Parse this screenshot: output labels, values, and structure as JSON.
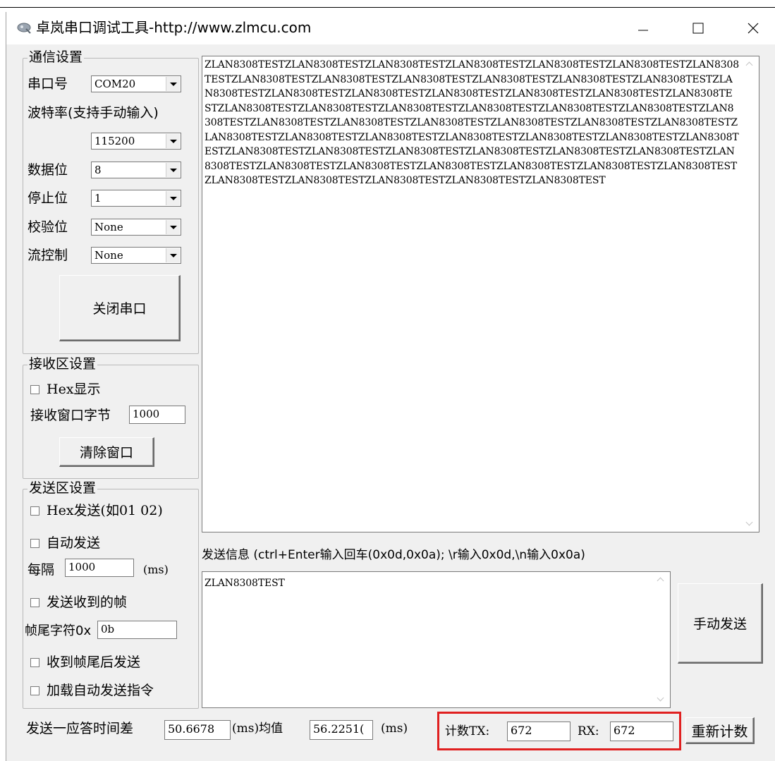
{
  "window": {
    "title": "卓岚串口调试工具-http://www.zlmcu.com"
  },
  "comm": {
    "legend": "通信设置",
    "port_label": "串口号",
    "port_value": "COM20",
    "baud_label": "波特率(支持手动输入)",
    "baud_value": "115200",
    "databits_label": "数据位",
    "databits_value": "8",
    "stopbits_label": "停止位",
    "stopbits_value": "1",
    "parity_label": "校验位",
    "parity_value": "None",
    "flow_label": "流控制",
    "flow_value": "None",
    "close_port_button": "关闭串口"
  },
  "receive": {
    "legend": "接收区设置",
    "hex_display_label": "Hex显示",
    "window_bytes_label": "接收窗口字节",
    "window_bytes_value": "1000",
    "clear_button": "清除窗口"
  },
  "send": {
    "legend": "发送区设置",
    "hex_send_label": "Hex发送(如01 02)",
    "auto_send_label": "自动发送",
    "interval_label": "每隔",
    "interval_value": "1000",
    "interval_unit": "(ms)",
    "send_received_label": "发送收到的帧",
    "frame_tail_label": "帧尾字符0x",
    "frame_tail_value": "0b",
    "send_after_tail_label": "收到帧尾后发送",
    "load_auto_label": "加载自动发送指令"
  },
  "receive_text": "ZLAN8308TESTZLAN8308TESTZLAN8308TESTZLAN8308TESTZLAN8308TESTZLAN8308TESTZLAN8308TESTZLAN8308TESTZLAN8308TESTZLAN8308TESTZLAN8308TESTZLAN8308TESTZLAN8308TESTZLAN8308TESTZLAN8308TESTZLAN8308TESTZLAN8308TESTZLAN8308TESTZLAN8308TESTZLAN8308TESTZLAN8308TESTZLAN8308TESTZLAN8308TESTZLAN8308TESTZLAN8308TESTZLAN8308TESTZLAN8308TESTZLAN8308TESTZLAN8308TESTZLAN8308TESTZLAN8308TESTZLAN8308TESTZLAN8308TESTZLAN8308TESTZLAN8308TESTZLAN8308TESTZLAN8308TESTZLAN8308TESTZLAN8308TESTZLAN8308TESTZLAN8308TESTZLAN8308TESTZLAN8308TESTZLAN8308TESTZLAN8308TESTZLAN8308TESTZLAN8308TESTZLAN8308TESTZLAN8308TESTZLAN8308TESTZLAN8308TESTZLAN8308TESTZLAN8308TESTZLAN8308TESTZLAN8308TESTZLAN8308TESTZLAN8308TESTZLAN8308TEST",
  "send_info_label": "发送信息 (ctrl+Enter输入回车(0x0d,0x0a); \\r输入0x0d,\\n输入0x0a)",
  "send_text": "ZLAN8308TEST",
  "manual_send_button": "手动发送",
  "bottom": {
    "timing_label": "发送一应答时间差",
    "timing_value": "50.6678",
    "unit1": "(ms)均值",
    "avg_value": "56.2251(",
    "unit2": "(ms)",
    "tx_label": "计数TX:",
    "tx_value": "672",
    "rx_label": "RX:",
    "rx_value": "672",
    "reset_button": "重新计数"
  },
  "colors": {
    "highlight": "#e02020",
    "face": "#f0f0f0"
  }
}
